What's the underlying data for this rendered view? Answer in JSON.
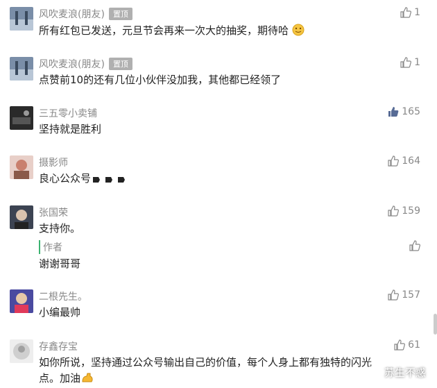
{
  "comments": [
    {
      "name": "风吹麦浪(朋友)",
      "tag": "置顶",
      "text": "所有红包已发送，元旦节会再来一次大的抽奖，期待哈",
      "likes": "1"
    },
    {
      "name": "风吹麦浪(朋友)",
      "tag": "置顶",
      "text": "点赞前10的还有几位小伙伴没加我，其他都已经领了",
      "likes": "1"
    },
    {
      "name": "三五零小卖铺",
      "text": "坚持就是胜利",
      "likes": "165"
    },
    {
      "name": "摄影师",
      "text": "良心公众号",
      "likes": "164"
    },
    {
      "name": "张国荣",
      "text": "支持你。",
      "likes": "159",
      "reply": {
        "label": "作者",
        "text": "谢谢哥哥"
      }
    },
    {
      "name": "二根先生。",
      "text": "小编最帅",
      "likes": "157"
    },
    {
      "name": "存鑫存宝",
      "text_line1": "如你所说，坚持通过公众号输出自己的价值，每个人身上都有独特的闪光",
      "text_line2": "点。加油",
      "likes": "61"
    }
  ],
  "watermark": "苏生不惑",
  "colors": {
    "liked": "#576b95",
    "muted": "#888888",
    "author_bar": "#3cb371"
  }
}
